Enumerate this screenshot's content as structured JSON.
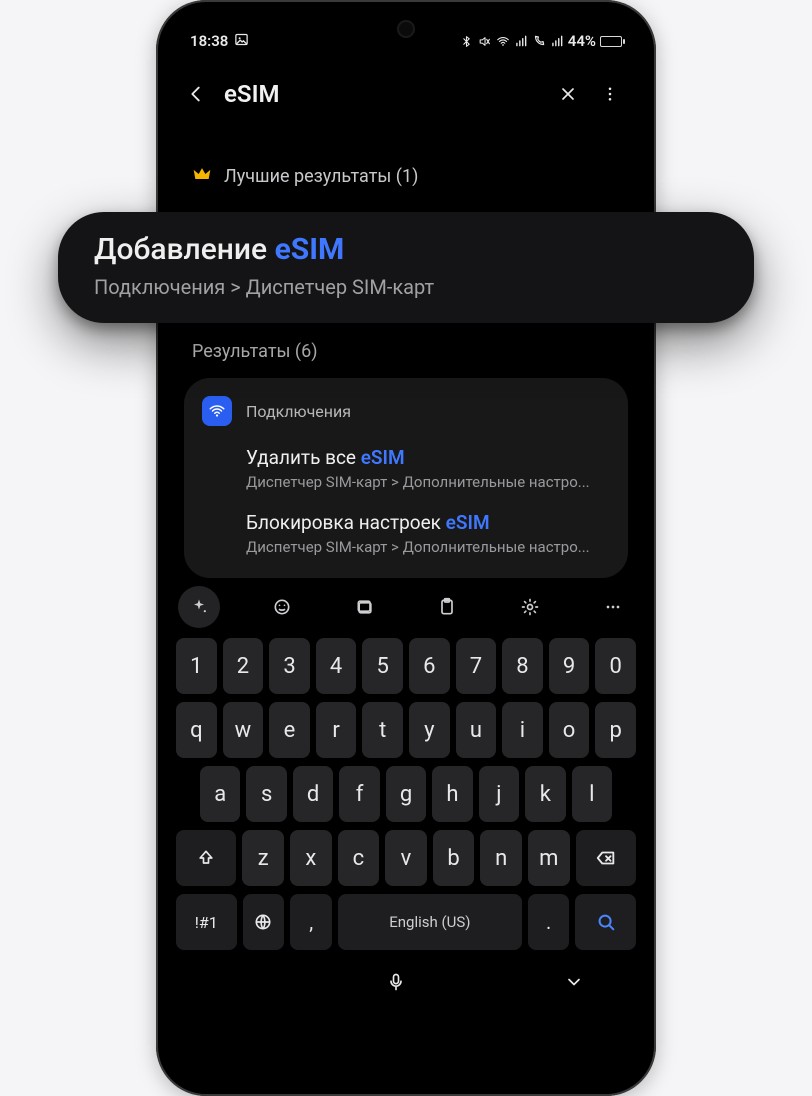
{
  "status": {
    "time": "18:38",
    "battery_pct": "44%"
  },
  "header": {
    "search_value": "eSIM"
  },
  "top_results": {
    "label_prefix": "Лучшие результаты (",
    "count": "1",
    "label_suffix": ")"
  },
  "highlight": {
    "title_pre": "Добавление ",
    "title_hl": "eSIM",
    "path": "Подключения > Диспетчер SIM-карт"
  },
  "results_section": {
    "label_prefix": "Результаты (",
    "count": "6",
    "label_suffix": ")"
  },
  "results_group": {
    "category": "Подключения",
    "items": [
      {
        "title_pre": "Удалить все ",
        "title_hl": "eSIM",
        "title_post": "",
        "path": "Диспетчер SIM-карт > Дополнительные настро..."
      },
      {
        "title_pre": "Блокировка настроек ",
        "title_hl": "eSIM",
        "title_post": "",
        "path": "Диспетчер SIM-карт > Дополнительные настро..."
      }
    ]
  },
  "keyboard": {
    "row1": [
      "1",
      "2",
      "3",
      "4",
      "5",
      "6",
      "7",
      "8",
      "9",
      "0"
    ],
    "row2": [
      "q",
      "w",
      "e",
      "r",
      "t",
      "y",
      "u",
      "i",
      "o",
      "p"
    ],
    "row3": [
      "a",
      "s",
      "d",
      "f",
      "g",
      "h",
      "j",
      "k",
      "l"
    ],
    "row4": [
      "z",
      "x",
      "c",
      "v",
      "b",
      "n",
      "m"
    ],
    "sym_label": "!#1",
    "comma": ",",
    "space_label": "English (US)",
    "period": "."
  }
}
